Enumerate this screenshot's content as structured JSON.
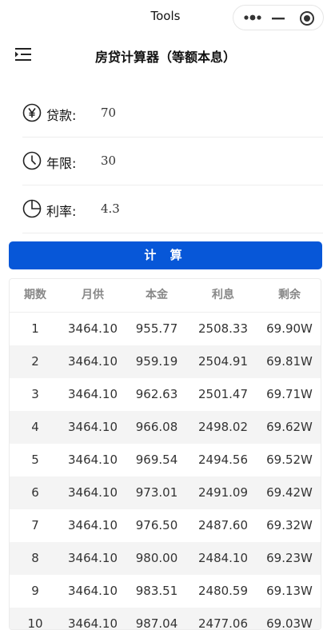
{
  "window": {
    "title": "Tools",
    "capsule_icons": [
      "more-icon",
      "minimize-icon",
      "record-icon"
    ]
  },
  "page": {
    "title": "房贷计算器（等额本息）",
    "menu_icon": "menu-icon"
  },
  "form": [
    {
      "icon": "yen-icon",
      "label": "贷款:",
      "value": "70"
    },
    {
      "icon": "clock-icon",
      "label": "年限:",
      "value": "30"
    },
    {
      "icon": "pie-icon",
      "label": "利率:",
      "value": "4.3"
    }
  ],
  "calculate_label": "计 算",
  "colors": {
    "primary": "#0757d8",
    "row_alt": "#f4f4f4"
  },
  "table": {
    "headers": [
      "期数",
      "月供",
      "本金",
      "利息",
      "剩余"
    ],
    "rows": [
      [
        "1",
        "3464.10",
        "955.77",
        "2508.33",
        "69.90W"
      ],
      [
        "2",
        "3464.10",
        "959.19",
        "2504.91",
        "69.81W"
      ],
      [
        "3",
        "3464.10",
        "962.63",
        "2501.47",
        "69.71W"
      ],
      [
        "4",
        "3464.10",
        "966.08",
        "2498.02",
        "69.62W"
      ],
      [
        "5",
        "3464.10",
        "969.54",
        "2494.56",
        "69.52W"
      ],
      [
        "6",
        "3464.10",
        "973.01",
        "2491.09",
        "69.42W"
      ],
      [
        "7",
        "3464.10",
        "976.50",
        "2487.60",
        "69.32W"
      ],
      [
        "8",
        "3464.10",
        "980.00",
        "2484.10",
        "69.23W"
      ],
      [
        "9",
        "3464.10",
        "983.51",
        "2480.59",
        "69.13W"
      ],
      [
        "10",
        "3464.10",
        "987.04",
        "2477.06",
        "69.03W"
      ]
    ]
  }
}
